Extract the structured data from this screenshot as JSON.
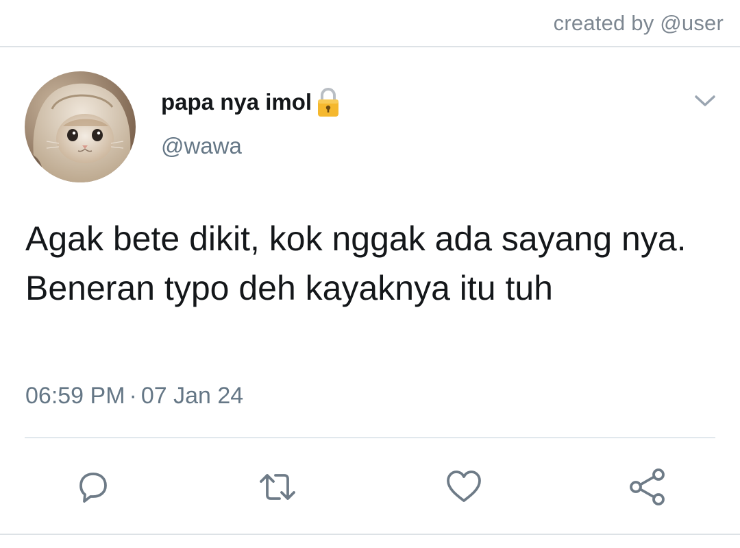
{
  "header": {
    "credit": "created by @user"
  },
  "tweet": {
    "author": {
      "display_name": "papa nya imol",
      "handle": "@wawa",
      "locked_icon": "lock-icon",
      "avatar": "cat-avatar"
    },
    "text": "Agak bete dikit, kok nggak ada sayang nya. Beneran typo deh kayaknya itu tuh",
    "time": "06:59 PM",
    "separator": "·",
    "date": "07 Jan 24"
  },
  "actions": [
    {
      "icon": "reply-icon"
    },
    {
      "icon": "retweet-icon"
    },
    {
      "icon": "like-icon"
    },
    {
      "icon": "share-icon"
    }
  ],
  "colors": {
    "text": "#14171a",
    "secondary": "#657786",
    "icon": "#6e7b87",
    "divider": "#e1e8ed",
    "lock": "#f5b82e"
  }
}
